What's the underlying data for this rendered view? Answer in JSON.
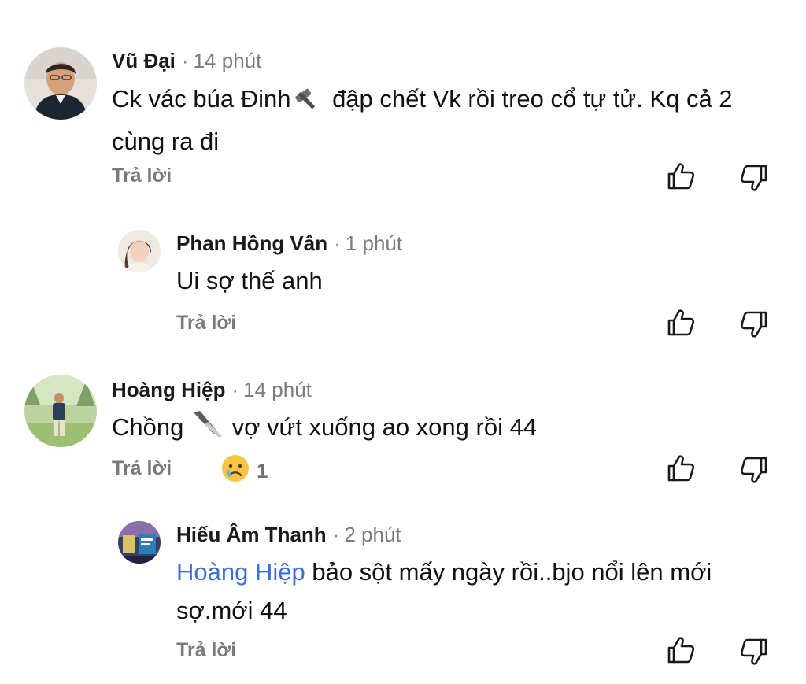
{
  "comments": [
    {
      "author": "Vũ Đại",
      "separator": "·",
      "time": "14 phút",
      "text_part1": "Ck vác búa Đinh",
      "emoji1_icon": "hammer-icon",
      "text_part2": " đập chết Vk rồi treo cổ tự tử. Kq cả 2 cùng ra đi",
      "reply_label": "Trả lời"
    },
    {
      "author": "Phan Hồng Vân",
      "separator": "·",
      "time": "1 phút",
      "text": "Ui sợ thế anh",
      "reply_label": "Trả lời"
    },
    {
      "author": "Hoàng Hiệp",
      "separator": "·",
      "time": "14 phút",
      "text_part1": "Chồng ",
      "emoji1_icon": "knife-icon",
      "text_part2": " vợ vứt xuống ao xong rồi 44",
      "reply_label": "Trả lời",
      "reaction_icon": "sad-face-icon",
      "reaction_count": "1"
    },
    {
      "author": "Hiếu Âm Thanh",
      "separator": "·",
      "time": "2 phút",
      "mention": "Hoàng Hiệp",
      "text": " bảo sột mấy ngày rồi..bjo nổi lên mới sợ.mới 44",
      "reply_label": "Trả lời"
    }
  ],
  "icons": {
    "like": "thumbs-up-icon",
    "dislike": "thumbs-down-icon"
  },
  "colors": {
    "mention": "#3a6fd8",
    "meta_text": "#7b7b7b"
  }
}
